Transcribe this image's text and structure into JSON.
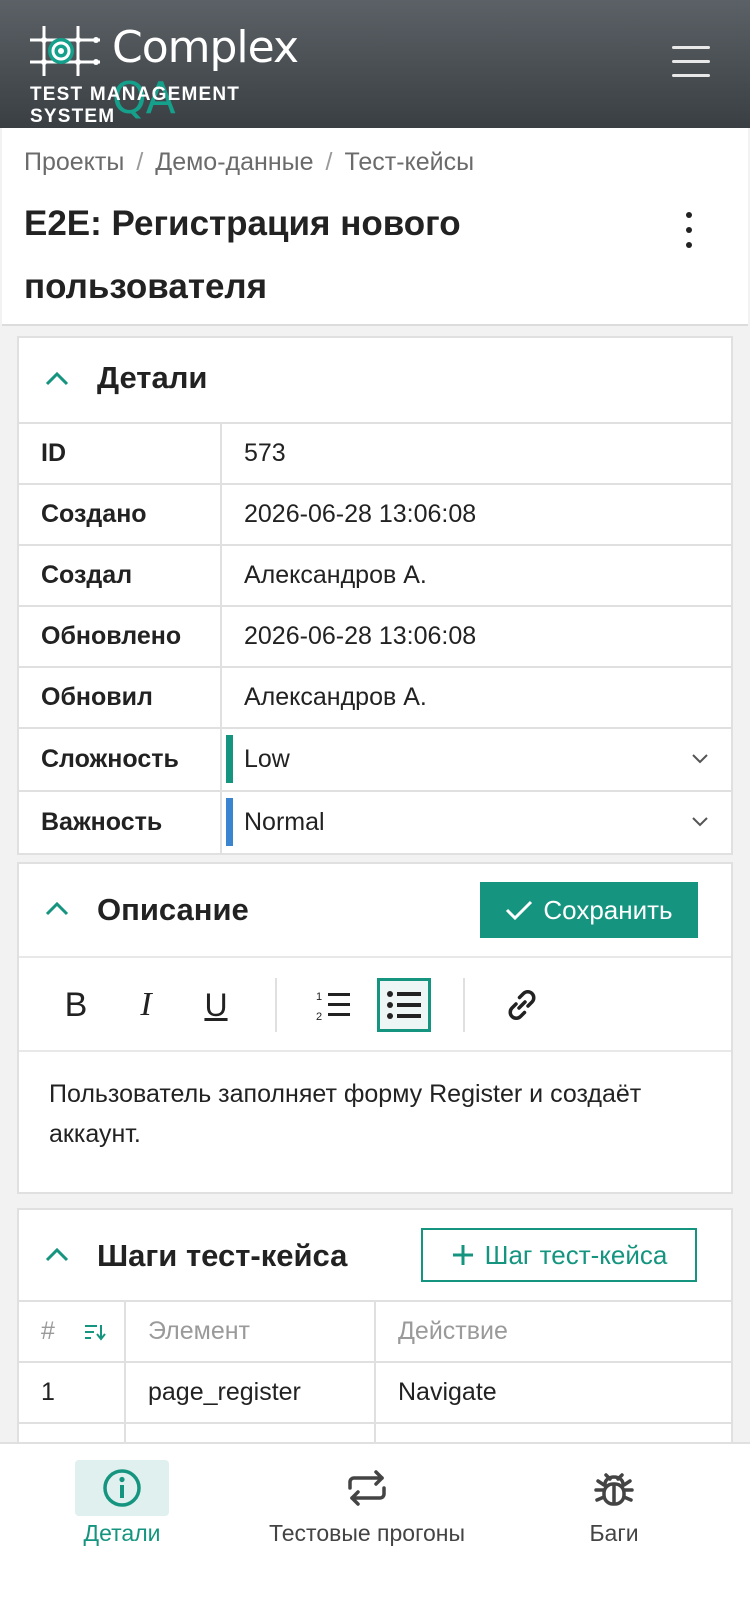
{
  "header": {
    "logo_name": "Complex",
    "logo_name_accent": "QA",
    "logo_subtitle": "TEST MANAGEMENT SYSTEM"
  },
  "breadcrumb": [
    "Проекты",
    "Демо-данные",
    "Тест-кейсы"
  ],
  "page_title": "E2E: Регистрация нового пользователя",
  "details": {
    "title": "Детали",
    "rows": [
      {
        "label": "ID",
        "value": "573"
      },
      {
        "label": "Создано",
        "value": "2026-06-28 13:06:08"
      },
      {
        "label": "Создал",
        "value": "Александров А."
      },
      {
        "label": "Обновлено",
        "value": "2026-06-28 13:06:08"
      },
      {
        "label": "Обновил",
        "value": "Александров А."
      }
    ],
    "complexity": {
      "label": "Сложность",
      "value": "Low",
      "color": "#15957f"
    },
    "importance": {
      "label": "Важность",
      "value": "Normal",
      "color": "#3a84d0"
    }
  },
  "description": {
    "title": "Описание",
    "save_label": "Сохранить",
    "text": "Пользователь заполняет форму Register и создаёт аккаунт.",
    "toolbar": [
      "bold-icon",
      "italic-icon",
      "underline-icon",
      "ordered-list-icon",
      "bullet-list-icon",
      "link-icon"
    ]
  },
  "steps": {
    "title": "Шаги тест-кейса",
    "add_label": "Шаг тест-кейса",
    "columns": [
      "#",
      "Элемент",
      "Действие"
    ],
    "rows": [
      {
        "num": "1",
        "element": "page_register",
        "action": "Navigate"
      }
    ]
  },
  "bottom_nav": [
    {
      "label": "Детали",
      "icon": "info-icon",
      "active": true
    },
    {
      "label": "Тестовые прогоны",
      "icon": "repeat-icon",
      "active": false
    },
    {
      "label": "Баги",
      "icon": "bug-icon",
      "active": false
    }
  ],
  "colors": {
    "accent": "#15957f",
    "header_bg": "#474c50"
  }
}
